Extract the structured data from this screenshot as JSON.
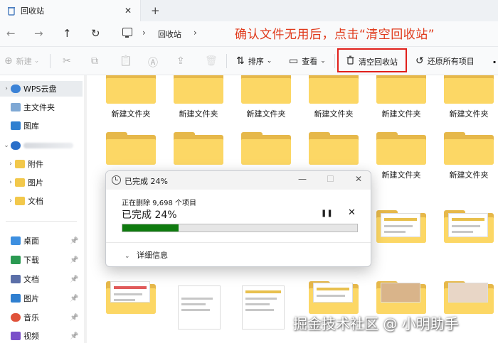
{
  "tab": {
    "title": "回收站",
    "close_glyph": "✕",
    "add_glyph": "+"
  },
  "nav": {
    "back_glyph": "←",
    "forward_glyph": "→",
    "up_glyph": "↑",
    "refresh_glyph": "↻",
    "breadcrumb_sep": "›",
    "breadcrumb": "回收站"
  },
  "annotation": "确认文件无用后，点击“清空回收站”",
  "toolbar": {
    "new_label": "新建",
    "new_glyph": "⊕",
    "cut_glyph": "✂",
    "copy_glyph": "⧉",
    "paste_glyph": "📋",
    "rename_glyph": "Ⓐ",
    "share_glyph": "⇪",
    "delete_glyph": "🗑",
    "sort_label": "排序",
    "sort_glyph": "⇅",
    "view_label": "查看",
    "view_glyph": "▭",
    "empty_bin_label": "清空回收站",
    "empty_bin_glyph": "🗑",
    "restore_all_label": "还原所有项目",
    "restore_all_glyph": "↺",
    "more_glyph": "·",
    "chevron": "⌄"
  },
  "sidebar": {
    "wps": "WPS云盘",
    "home": "主文件夹",
    "gallery": "图库",
    "sub_items": [
      "附件",
      "图片",
      "文档"
    ],
    "quick_access": [
      "桌面",
      "下载",
      "文档",
      "图片",
      "音乐",
      "视频"
    ],
    "chevron_right": "›",
    "chevron_down": "⌄",
    "pin_glyph": "📌"
  },
  "folders": {
    "label": "新建文件夹"
  },
  "dialog": {
    "title": "已完成 24%",
    "status": "正在删除 9,698 个项目",
    "big_status": "已完成 24%",
    "progress": 0.24,
    "details_label": "详细信息",
    "minimize_glyph": "—",
    "maximize_glyph": "☐",
    "close_glyph": "✕",
    "pause_glyph": "❚❚",
    "stop_glyph": "✕",
    "details_chevron": "⌄"
  },
  "watermark": "掘金技术社区 @ 小明助手",
  "colors": {
    "accent_red": "#e0201b",
    "annotation_red": "#e03a1b",
    "progress_green": "#0f7b0f",
    "folder_yellow": "#fcd765"
  }
}
